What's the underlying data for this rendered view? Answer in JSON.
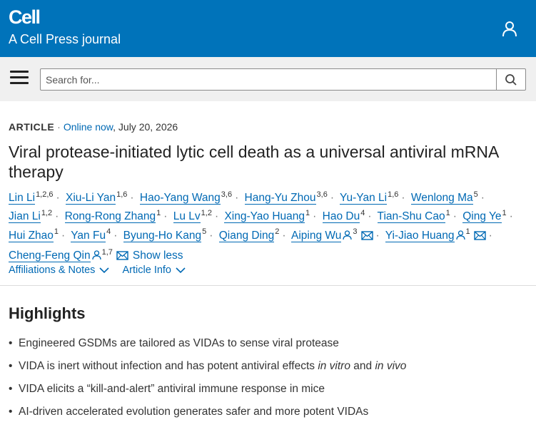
{
  "header": {
    "logo": "Cell",
    "tagline": "A Cell Press journal",
    "account_icon": "user-icon"
  },
  "search": {
    "placeholder": "Search for...",
    "menu_icon": "hamburger-menu-icon",
    "button_icon": "search-icon"
  },
  "article": {
    "type": "ARTICLE",
    "status": "Online now",
    "date": ", July 20, 2026",
    "title": "Viral protease-initiated lytic cell death as a universal antiviral mRNA therapy",
    "authors": [
      {
        "name": "Lin Li",
        "sup": "1,2,6"
      },
      {
        "name": "Xiu-Li Yan",
        "sup": "1,6"
      },
      {
        "name": "Hao-Yang Wang",
        "sup": "3,6"
      },
      {
        "name": "Hang-Yu Zhou",
        "sup": "3,6"
      },
      {
        "name": "Yu-Yan Li",
        "sup": "1,6"
      },
      {
        "name": "Wenlong Ma",
        "sup": "5"
      },
      {
        "name": "Jian Li",
        "sup": "1,2"
      },
      {
        "name": "Rong-Rong Zhang",
        "sup": "1"
      },
      {
        "name": "Lu Lv",
        "sup": "1,2"
      },
      {
        "name": "Xing-Yao Huang",
        "sup": "1"
      },
      {
        "name": "Hao Du",
        "sup": "4"
      },
      {
        "name": "Tian-Shu Cao",
        "sup": "1"
      },
      {
        "name": "Qing Ye",
        "sup": "1"
      },
      {
        "name": "Hui Zhao",
        "sup": "1"
      },
      {
        "name": "Yan Fu",
        "sup": "4"
      },
      {
        "name": "Byung-Ho Kang",
        "sup": "5"
      },
      {
        "name": "Qiang Ding",
        "sup": "2"
      },
      {
        "name": "Aiping Wu",
        "sup": "3",
        "corresponding": true
      },
      {
        "name": "Yi-Jiao Huang",
        "sup": "1",
        "corresponding": true
      },
      {
        "name": "Cheng-Feng Qin",
        "sup": "1,7",
        "corresponding": true
      }
    ],
    "show_less": "Show less",
    "affiliations_label": "Affiliations & Notes",
    "article_info_label": "Article Info"
  },
  "highlights": {
    "title": "Highlights",
    "items": [
      {
        "text": "Engineered GSDMs are tailored as VIDAs to sense viral protease"
      },
      {
        "pre": "VIDA is inert without infection and has potent antiviral effects ",
        "em1": "in vitro",
        "mid": " and ",
        "em2": "in vivo"
      },
      {
        "text": "VIDA elicits a “kill-and-alert” antiviral immune response in mice"
      },
      {
        "text": "AI-driven accelerated evolution generates safer and more potent VIDAs"
      }
    ]
  },
  "colors": {
    "brand": "#0073ba",
    "link": "#0069b4"
  }
}
